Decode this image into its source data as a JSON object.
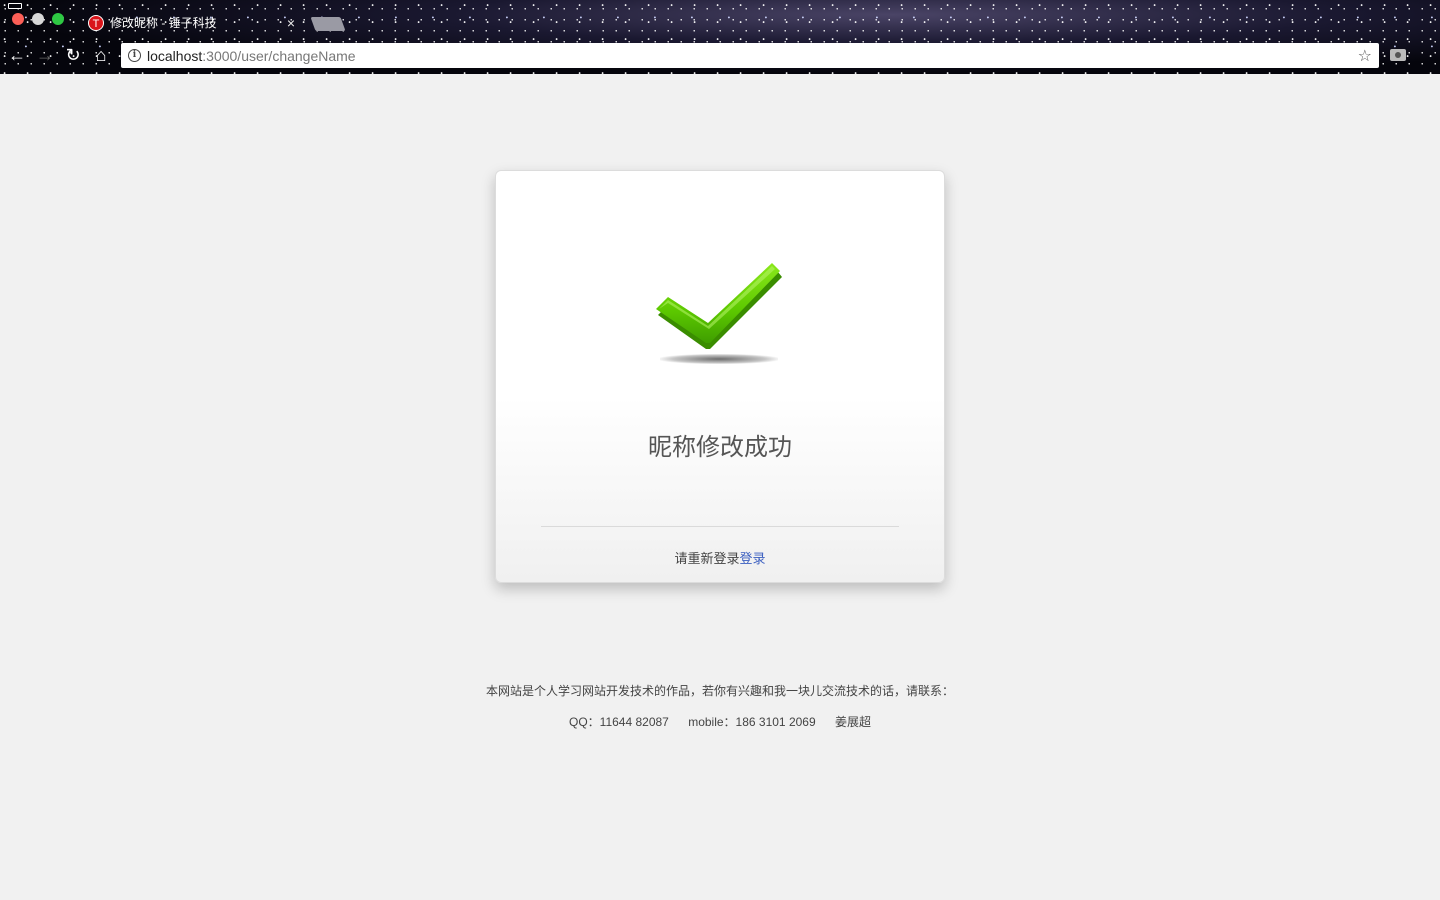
{
  "browser": {
    "tab_title": "修改昵称 - 锤子科技",
    "favicon_letter": "T",
    "tab_close": "×",
    "url_host": "localhost",
    "url_rest": ":3000/user/changeName",
    "info_glyph": "i",
    "star_glyph": "☆",
    "back_glyph": "←",
    "forward_glyph": "→",
    "reload_glyph": "↻",
    "home_glyph": "⌂"
  },
  "card": {
    "title": "昵称修改成功",
    "relogin_prefix": "请重新登录",
    "relogin_link": "登录",
    "check_color": "#66d100"
  },
  "footer": {
    "intro": "本网站是个人学习网站开发技术的作品，若你有兴趣和我一块儿交流技术的话，请联系：",
    "qq": "QQ：11644 82087",
    "mobile": "mobile：186 3101 2069",
    "name": "姜展超"
  }
}
